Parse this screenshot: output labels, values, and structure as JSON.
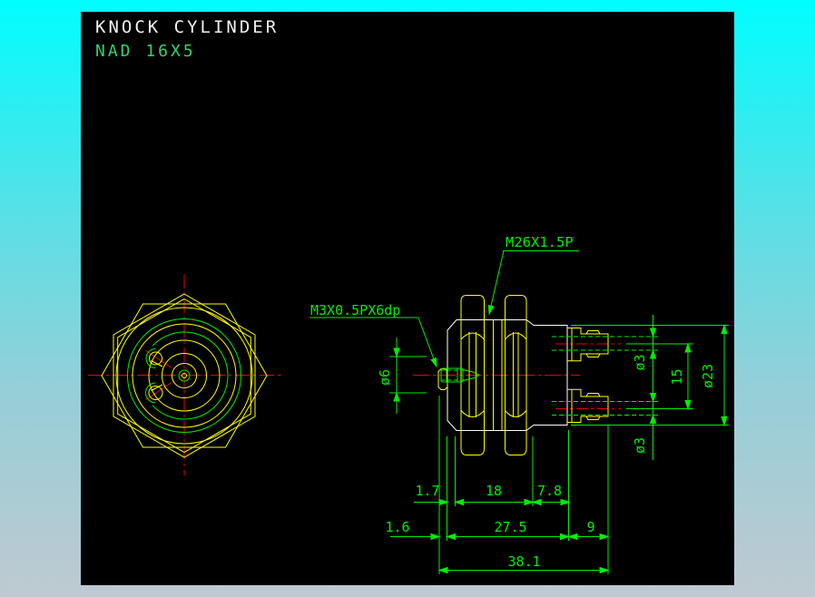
{
  "title": {
    "line1": "KNOCK CYLINDER",
    "line2": "NAD 16X5"
  },
  "labels": {
    "thread_callout": "M26X1.5P",
    "port_callout": "M3X0.5PX6dp"
  },
  "dimensions": {
    "boss_dia": "ø6",
    "port_dia_top": "ø3",
    "port_dia_bottom": "ø3",
    "port_spacing": "15",
    "body_dia": "ø23",
    "row1": [
      "1.7",
      "18",
      "7.8"
    ],
    "row2": [
      "1.6",
      "27.5",
      "9"
    ],
    "row3": [
      "38.1"
    ]
  },
  "colors": {
    "line_yellow": "#ffff00",
    "line_green": "#00ee00",
    "line_red": "#e80000",
    "line_white": "#ffffff",
    "text_title": "#f2f2f2",
    "text_subtitle": "#2fd26e",
    "canvas_black": "#000000",
    "bg_top_cyan": "#00feff",
    "bg_bottom_grey": "#bfc9d1"
  }
}
